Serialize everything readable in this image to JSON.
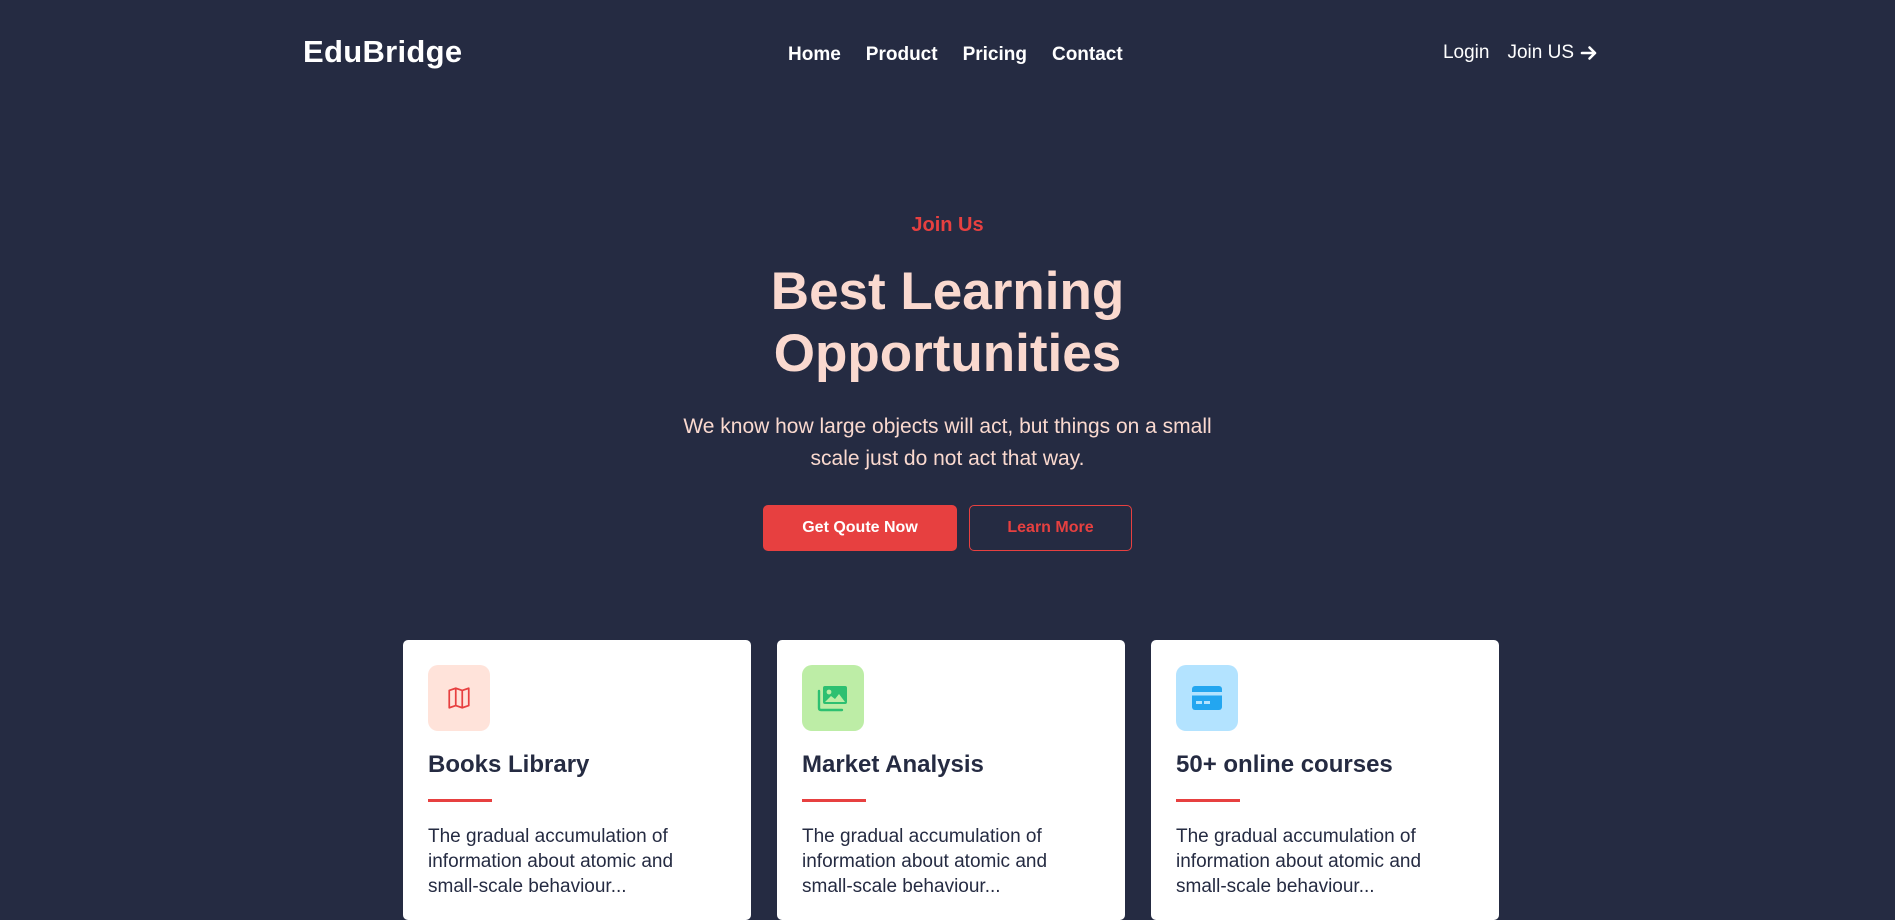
{
  "header": {
    "logo": "EduBridge",
    "nav": [
      "Home",
      "Product",
      "Pricing",
      "Contact"
    ],
    "login": "Login",
    "join": "Join US"
  },
  "hero": {
    "eyebrow": "Join Us",
    "title_line1": "Best Learning",
    "title_line2": "Opportunities",
    "subtitle": "We know how large objects will act, but things on a small scale just do not act that way.",
    "primary_button": "Get Qoute Now",
    "secondary_button": "Learn More"
  },
  "cards": [
    {
      "title": "Books Library",
      "text": "The gradual accumulation of information about atomic and small-scale behaviour...",
      "icon": "map-icon",
      "icon_bg": "#FFE3DA",
      "icon_color": "#E74040"
    },
    {
      "title": "Market Analysis",
      "text": "The gradual accumulation of information about atomic and small-scale behaviour...",
      "icon": "images-icon",
      "icon_bg": "#BDEDA6",
      "icon_color": "#2DC071"
    },
    {
      "title": "50+ online courses",
      "text": "The gradual accumulation of information about atomic and small-scale behaviour...",
      "icon": "credit-card-icon",
      "icon_bg": "#B3E3FF",
      "icon_color": "#23A6F0"
    }
  ],
  "colors": {
    "background": "#252B42",
    "accent": "#E74040",
    "hero_text": "#FAD9CF",
    "white": "#FFFFFF"
  }
}
